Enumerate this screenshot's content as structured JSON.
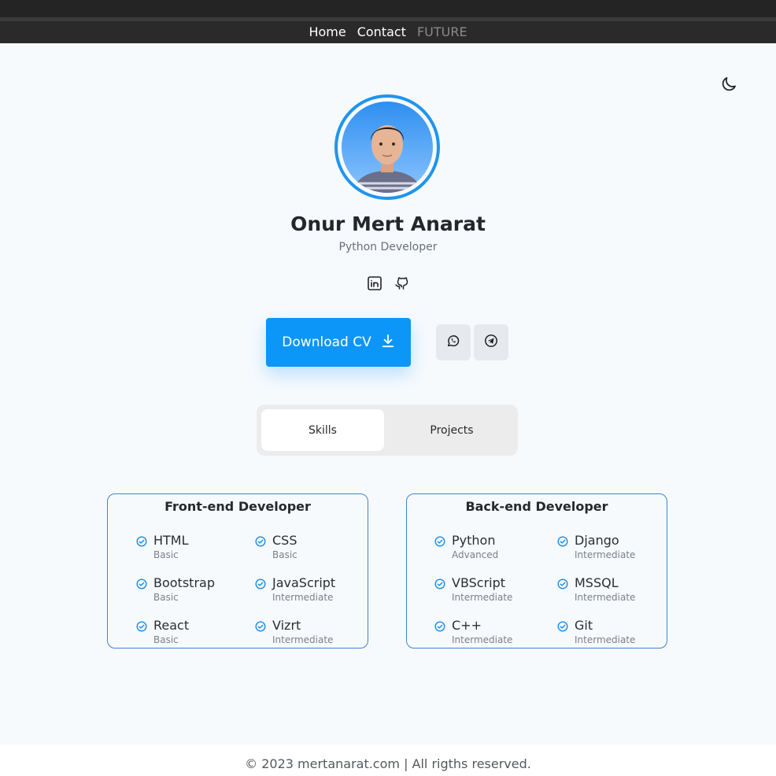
{
  "nav": {
    "items": [
      {
        "label": "Home"
      },
      {
        "label": "Contact"
      },
      {
        "label": "FUTURE"
      }
    ]
  },
  "theme_toggle": {
    "icon": "moon-icon"
  },
  "profile": {
    "name": "Onur Mert Anarat",
    "role": "Python Developer",
    "socials": [
      {
        "icon": "linkedin-icon"
      },
      {
        "icon": "github-icon"
      }
    ]
  },
  "actions": {
    "download_cv_label": "Download CV",
    "download_icon": "download-icon",
    "whatsapp_icon": "whatsapp-icon",
    "telegram_icon": "telegram-icon"
  },
  "tabs": [
    {
      "label": "Skills",
      "active": true
    },
    {
      "label": "Projects",
      "active": false
    }
  ],
  "skills": {
    "frontend": {
      "title": "Front-end Developer",
      "items": [
        {
          "name": "HTML",
          "level": "Basic"
        },
        {
          "name": "CSS",
          "level": "Basic"
        },
        {
          "name": "Bootstrap",
          "level": "Basic"
        },
        {
          "name": "JavaScript",
          "level": "Intermediate"
        },
        {
          "name": "React",
          "level": "Basic"
        },
        {
          "name": "Vizrt",
          "level": "Intermediate"
        }
      ]
    },
    "backend": {
      "title": "Back-end Developer",
      "items": [
        {
          "name": "Python",
          "level": "Advanced"
        },
        {
          "name": "Django",
          "level": "Intermediate"
        },
        {
          "name": "VBScript",
          "level": "Intermediate"
        },
        {
          "name": "MSSQL",
          "level": "Intermediate"
        },
        {
          "name": "C++",
          "level": "Intermediate"
        },
        {
          "name": "Git",
          "level": "Intermediate"
        }
      ]
    }
  },
  "footer": {
    "text": "© 2023 mertanarat.com | All rigths reserved."
  },
  "colors": {
    "accent": "#0c96f7",
    "nav_bg": "#2a2a2a",
    "card_border": "#3f82d6",
    "page_bg": "#f7fafd"
  }
}
